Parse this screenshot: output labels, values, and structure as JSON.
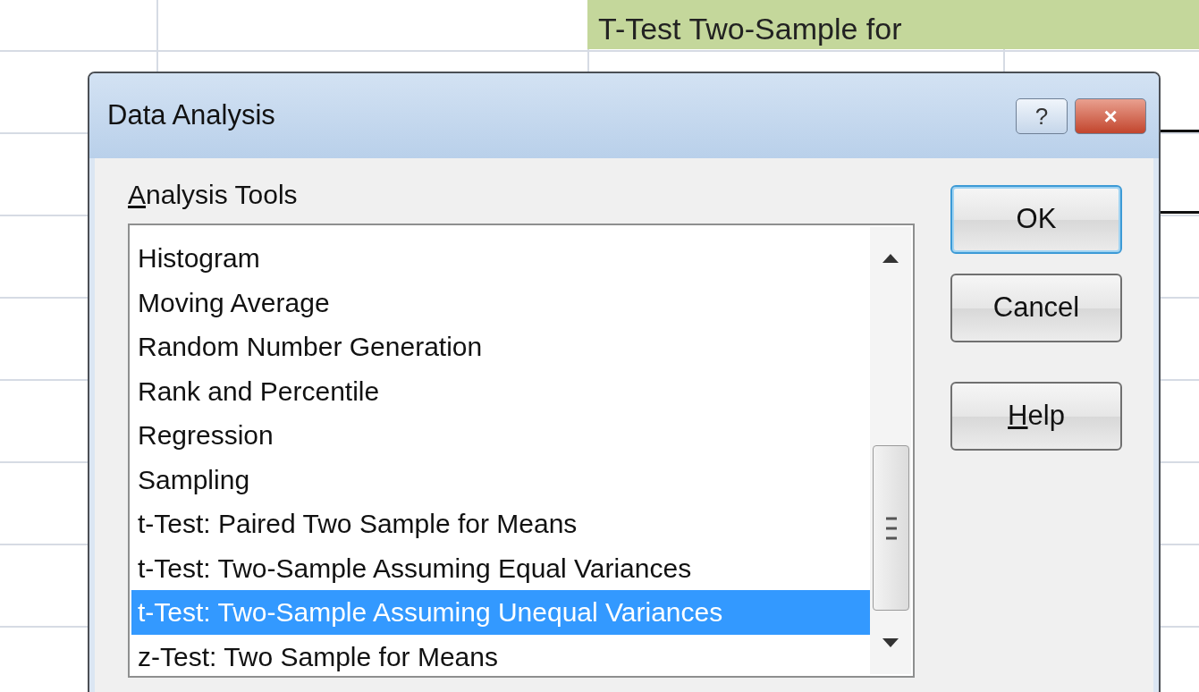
{
  "background": {
    "banner": "T-Test Two-Sample for"
  },
  "window": {
    "title": "Data Analysis",
    "title_buttons": [
      {
        "kind": "help",
        "label": "?"
      },
      {
        "kind": "close",
        "label": "×"
      }
    ]
  },
  "list_label": {
    "text": "Analysis Tools",
    "first_letter_underlined": true
  },
  "list_items": [
    {
      "label": "Histogram",
      "selected": false
    },
    {
      "label": "Moving Average",
      "selected": false
    },
    {
      "label": "Random Number Generation",
      "selected": false
    },
    {
      "label": "Rank and Percentile",
      "selected": false
    },
    {
      "label": "Regression",
      "selected": false
    },
    {
      "label": "Sampling",
      "selected": false
    },
    {
      "label": "t-Test: Paired Two Sample for Means",
      "selected": false
    },
    {
      "label": "t-Test: Two-Sample Assuming Equal Variances",
      "selected": false
    },
    {
      "label": "t-Test: Two-Sample Assuming Unequal Variances",
      "selected": true
    },
    {
      "label": "z-Test: Two Sample for Means",
      "selected": false
    }
  ],
  "buttons": [
    {
      "label": "OK",
      "default": true
    },
    {
      "label": "Cancel",
      "default": false
    },
    {
      "label": "Help",
      "default": false,
      "first_letter_underlined": true
    }
  ]
}
